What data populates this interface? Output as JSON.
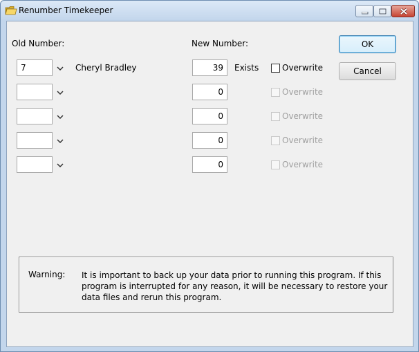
{
  "window": {
    "title": "Renumber Timekeeper"
  },
  "labels": {
    "old_number": "Old Number:",
    "new_number": "New Number:"
  },
  "buttons": {
    "ok": "OK",
    "cancel": "Cancel"
  },
  "rows": [
    {
      "old": "7",
      "name": "Cheryl Bradley",
      "new": "39",
      "status": "Exists",
      "overwrite_label": "Overwrite",
      "overwrite_enabled": true
    },
    {
      "old": "",
      "name": "",
      "new": "0",
      "status": "",
      "overwrite_label": "Overwrite",
      "overwrite_enabled": false
    },
    {
      "old": "",
      "name": "",
      "new": "0",
      "status": "",
      "overwrite_label": "Overwrite",
      "overwrite_enabled": false
    },
    {
      "old": "",
      "name": "",
      "new": "0",
      "status": "",
      "overwrite_label": "Overwrite",
      "overwrite_enabled": false
    },
    {
      "old": "",
      "name": "",
      "new": "0",
      "status": "",
      "overwrite_label": "Overwrite",
      "overwrite_enabled": false
    }
  ],
  "warning": {
    "label": "Warning:",
    "text": "It is important to back up your data prior to running this program. If this program is interrupted for any reason, it will be necessary to restore your data files and rerun this program."
  },
  "icons": {
    "title": "folder-icon",
    "dropdown": "chevron-down-icon",
    "minimize": "minimize-icon",
    "maximize": "maximize-icon",
    "close": "close-icon"
  },
  "colors": {
    "titlebar": "#c3d6ec",
    "close_button": "#c74432",
    "dialog_background": "#f0f0f0"
  }
}
